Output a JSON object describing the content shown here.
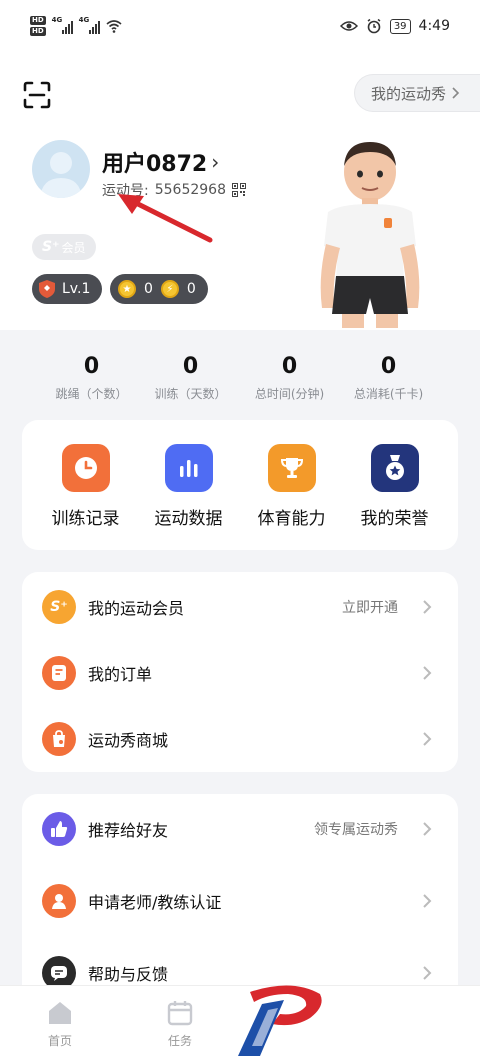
{
  "status": {
    "hd1": "HD",
    "hd2": "HD",
    "net1": "4G",
    "net2": "4G",
    "battery": "39",
    "time": "4:49"
  },
  "header": {
    "show_button": "我的运动秀",
    "username": "用户0872",
    "sport_id_label": "运动号:",
    "sport_id": "55652968",
    "member_tag": "会员",
    "member_tag_logo": "S⁺",
    "level": "Lv.1",
    "coin1": "0",
    "coin2": "0"
  },
  "stats": [
    {
      "value": "0",
      "label": "跳绳（个数）"
    },
    {
      "value": "0",
      "label": "训练（天数）"
    },
    {
      "value": "0",
      "label": "总时间(分钟)"
    },
    {
      "value": "0",
      "label": "总消耗(千卡)"
    }
  ],
  "quick": [
    {
      "label": "训练记录",
      "icon": "clock-icon",
      "color": "#f2703a"
    },
    {
      "label": "运动数据",
      "icon": "bar-chart-icon",
      "color": "#4f6cf3"
    },
    {
      "label": "体育能力",
      "icon": "trophy-icon",
      "color": "#f39a2a"
    },
    {
      "label": "我的荣誉",
      "icon": "medal-icon",
      "color": "#23357c"
    }
  ],
  "menu1": [
    {
      "label": "我的运动会员",
      "extra": "立即开通",
      "icon": "s-plus-icon",
      "color": "#f7a531"
    },
    {
      "label": "我的订单",
      "extra": "",
      "icon": "order-icon",
      "color": "#f2703a"
    },
    {
      "label": "运动秀商城",
      "extra": "",
      "icon": "shop-bag-icon",
      "color": "#f2703a"
    }
  ],
  "menu2": [
    {
      "label": "推荐给好友",
      "extra": "领专属运动秀",
      "icon": "thumb-up-icon",
      "color": "#6b5ce7"
    },
    {
      "label": "申请老师/教练认证",
      "extra": "",
      "icon": "person-icon",
      "color": "#f2703a"
    },
    {
      "label": "帮助与反馈",
      "extra": "",
      "icon": "chat-icon",
      "color": "#2a2a2a"
    }
  ],
  "tabs": [
    {
      "label": "首页",
      "icon": "home-icon"
    },
    {
      "label": "任务",
      "icon": "calendar-icon"
    }
  ]
}
